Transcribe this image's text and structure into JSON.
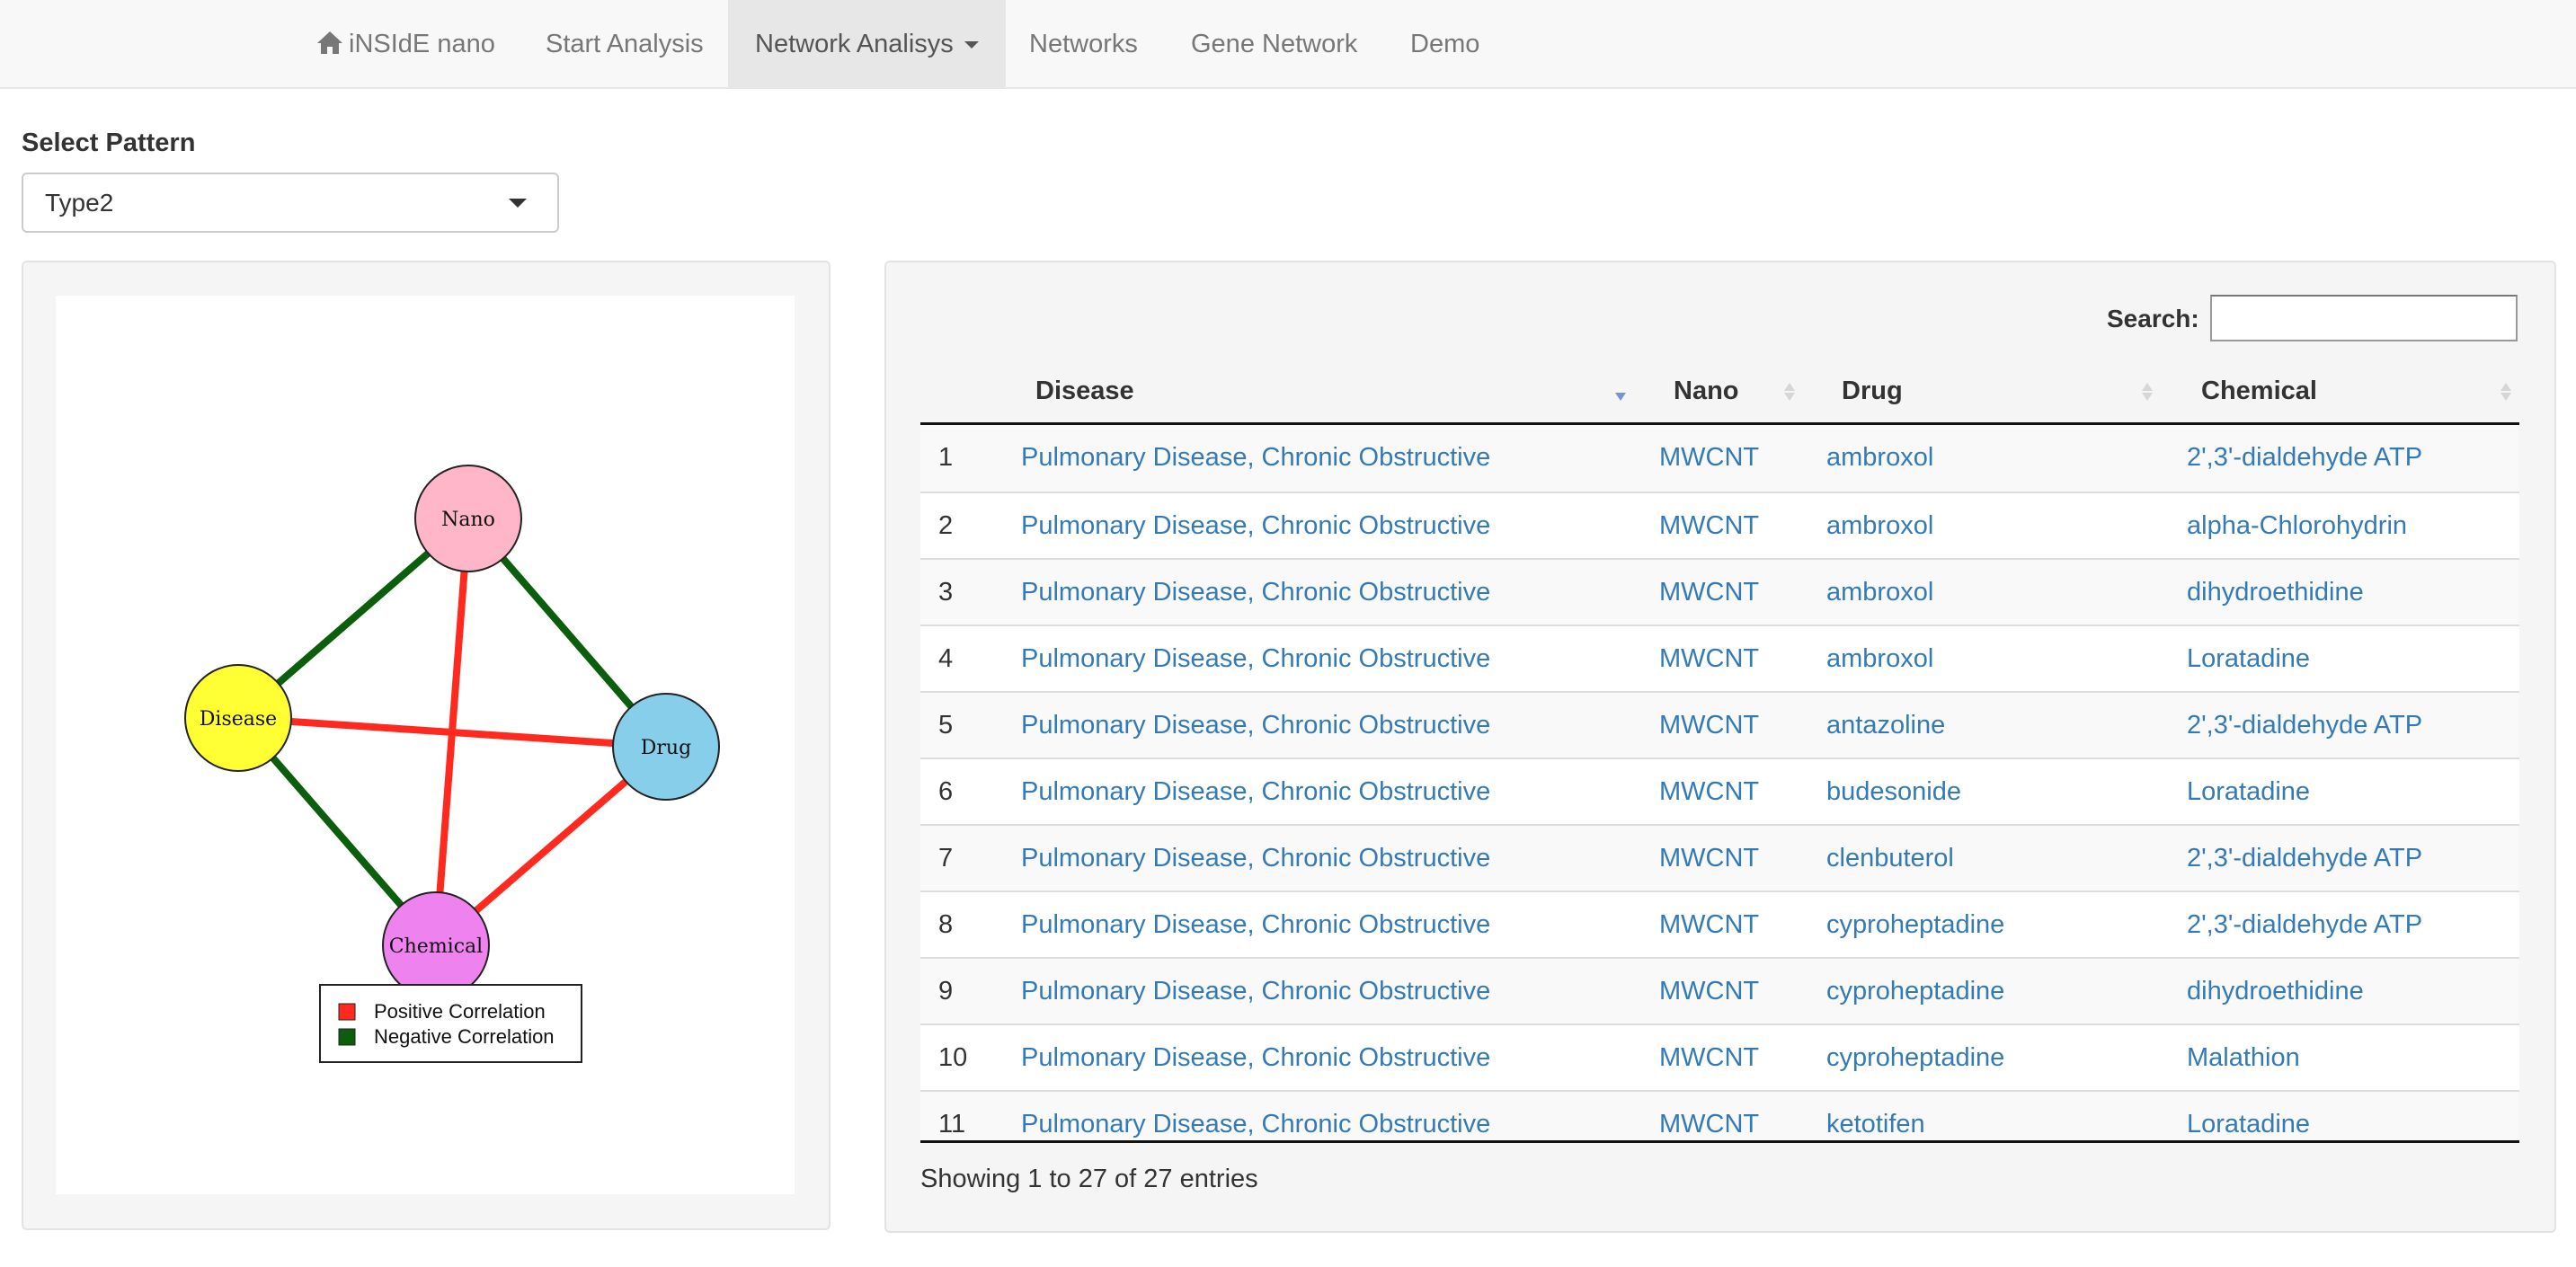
{
  "navbar": {
    "brand": "iNSIdE nano",
    "items": [
      "Start Analysis",
      "Network Analisys",
      "Networks",
      "Gene Network",
      "Demo"
    ],
    "active": "Network Analisys"
  },
  "select_pattern": {
    "label": "Select Pattern",
    "value": "Type2"
  },
  "network_plot": {
    "nodes": [
      {
        "label": "Nano",
        "color": "#FFB6C8"
      },
      {
        "label": "Disease",
        "color": "#FFFF33"
      },
      {
        "label": "Drug",
        "color": "#87CEEB"
      },
      {
        "label": "Chemical",
        "color": "#EE82EE"
      }
    ],
    "edges": [
      {
        "from": "Nano",
        "to": "Disease",
        "type": "negative"
      },
      {
        "from": "Nano",
        "to": "Drug",
        "type": "negative"
      },
      {
        "from": "Disease",
        "to": "Chemical",
        "type": "negative"
      },
      {
        "from": "Nano",
        "to": "Chemical",
        "type": "positive"
      },
      {
        "from": "Disease",
        "to": "Drug",
        "type": "positive"
      },
      {
        "from": "Drug",
        "to": "Chemical",
        "type": "positive"
      }
    ],
    "legend": [
      {
        "label": "Positive Correlation",
        "color": "#FF2A1F"
      },
      {
        "label": "Negative Correlation",
        "color": "#0B5E0B"
      }
    ]
  },
  "table": {
    "search_label": "Search:",
    "search_value": "",
    "columns": [
      "Disease",
      "Nano",
      "Drug",
      "Chemical"
    ],
    "rows": [
      {
        "n": "1",
        "disease": "Pulmonary Disease, Chronic Obstructive",
        "nano": "MWCNT",
        "drug": "ambroxol",
        "chemical": "2',3'-dialdehyde ATP"
      },
      {
        "n": "2",
        "disease": "Pulmonary Disease, Chronic Obstructive",
        "nano": "MWCNT",
        "drug": "ambroxol",
        "chemical": "alpha-Chlorohydrin"
      },
      {
        "n": "3",
        "disease": "Pulmonary Disease, Chronic Obstructive",
        "nano": "MWCNT",
        "drug": "ambroxol",
        "chemical": "dihydroethidine"
      },
      {
        "n": "4",
        "disease": "Pulmonary Disease, Chronic Obstructive",
        "nano": "MWCNT",
        "drug": "ambroxol",
        "chemical": "Loratadine"
      },
      {
        "n": "5",
        "disease": "Pulmonary Disease, Chronic Obstructive",
        "nano": "MWCNT",
        "drug": "antazoline",
        "chemical": "2',3'-dialdehyde ATP"
      },
      {
        "n": "6",
        "disease": "Pulmonary Disease, Chronic Obstructive",
        "nano": "MWCNT",
        "drug": "budesonide",
        "chemical": "Loratadine"
      },
      {
        "n": "7",
        "disease": "Pulmonary Disease, Chronic Obstructive",
        "nano": "MWCNT",
        "drug": "clenbuterol",
        "chemical": "2',3'-dialdehyde ATP"
      },
      {
        "n": "8",
        "disease": "Pulmonary Disease, Chronic Obstructive",
        "nano": "MWCNT",
        "drug": "cyproheptadine",
        "chemical": "2',3'-dialdehyde ATP"
      },
      {
        "n": "9",
        "disease": "Pulmonary Disease, Chronic Obstructive",
        "nano": "MWCNT",
        "drug": "cyproheptadine",
        "chemical": "dihydroethidine"
      },
      {
        "n": "10",
        "disease": "Pulmonary Disease, Chronic Obstructive",
        "nano": "MWCNT",
        "drug": "cyproheptadine",
        "chemical": "Malathion"
      },
      {
        "n": "11",
        "disease": "Pulmonary Disease, Chronic Obstructive",
        "nano": "MWCNT",
        "drug": "ketotifen",
        "chemical": "Loratadine"
      }
    ],
    "info": "Showing 1 to 27 of 27 entries"
  }
}
